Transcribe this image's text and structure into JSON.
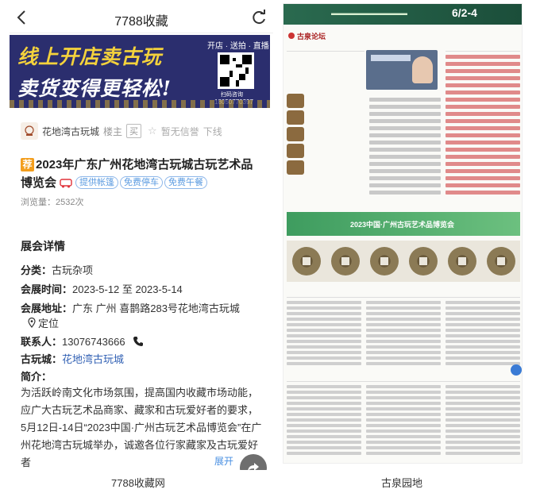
{
  "left_panel": {
    "topbar": {
      "title": "7788收藏",
      "back_icon": "back-arrow-icon",
      "refresh_icon": "refresh-icon"
    },
    "banner": {
      "line1": "线上开店卖古玩",
      "line2": "卖货变得更轻松!",
      "tagline": "开店 · 送拍 · 直播",
      "scan_text": "扫码咨询",
      "phone": "18050770397"
    },
    "shop": {
      "name": "花地湾古玩城",
      "role": "楼主",
      "buy": "买",
      "credit": "暂无信誉",
      "offline": "下线"
    },
    "post": {
      "badge": "荐",
      "title": "2023年广东广州花地湾古玩城古玩艺术品博览会",
      "tags": [
        "提供帐篷",
        "免费停车",
        "免费午餐"
      ],
      "views": "浏览量：2532次"
    },
    "details": {
      "section_title": "展会详情",
      "category_label": "分类：",
      "category_value": "古玩杂项",
      "time_label": "会展时间：",
      "time_value": "2023-5-12 至 2023-5-14",
      "address_label": "会展地址：",
      "address_value": "广东 广州 喜鹊路283号花地湾古玩城",
      "locate": "定位",
      "contact_label": "联系人：",
      "contact_value": "13076743666",
      "venue_label": "古玩城：",
      "venue_value": "花地湾古玩城",
      "intro_label": "简介：",
      "intro_text": "为活跃岭南文化市场氛围，提高国内收藏市场动能，应广大古玩艺术品商家、藏家和古玩爱好者的要求，5月12日-14日“2023中国·广州古玩艺术品博览会”在广州花地湾古玩城举办，诚邀各位行家藏家及古玩爱好者",
      "expand": "展开"
    },
    "caption": "7788收藏网"
  },
  "right_panel": {
    "banner_date": "6/2-4",
    "forum_title": "古泉论坛",
    "expo_banner": "2023中国·广州古玩艺术品博览会",
    "caption": "古泉园地"
  },
  "colors": {
    "banner_bg": "#2b2e6e",
    "banner_yellow": "#f4d23c",
    "recommend_badge": "#f39e1d",
    "tag_blue": "#5b9be0",
    "link_blue": "#2f5fb3",
    "expo_green": "#3e9c5f"
  }
}
